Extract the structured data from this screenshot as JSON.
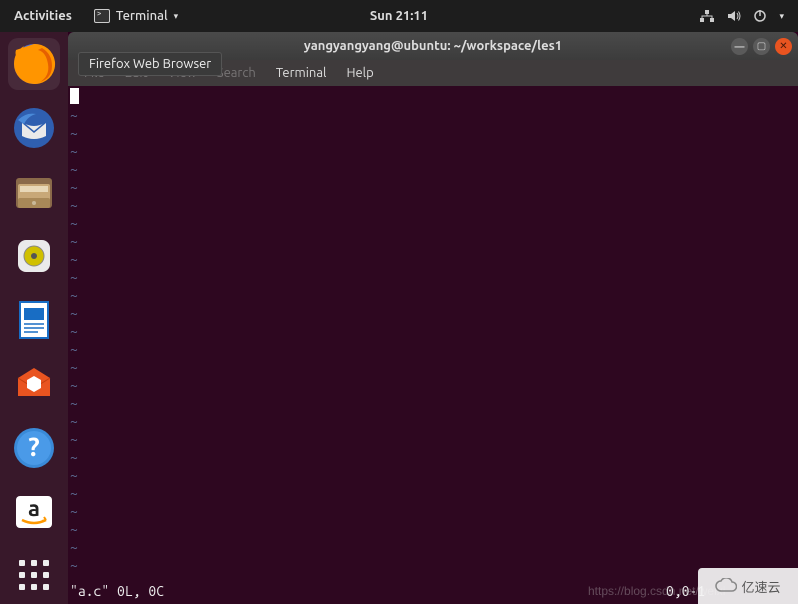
{
  "top_panel": {
    "activities": "Activities",
    "app_menu_label": "Terminal",
    "clock": "Sun 21:11"
  },
  "dock": {
    "tooltip_firefox": "Firefox Web Browser",
    "icons": [
      "firefox-icon",
      "thunderbird-icon",
      "files-icon",
      "rhythmbox-icon",
      "writer-icon",
      "software-icon",
      "help-icon",
      "amazon-icon"
    ]
  },
  "window": {
    "title": "yangyangyang@ubuntu: ~/workspace/les1",
    "menu": {
      "file": "File",
      "edit": "Edit",
      "view": "View",
      "search": "Search",
      "terminal": "Terminal",
      "help": "Help"
    }
  },
  "editor": {
    "tilde": "~",
    "tilde_count": 26,
    "status_file": "\"a.c\" 0L, 0C",
    "status_pos": "0,0-1"
  },
  "watermark": {
    "url": "https://blog.csdn.net/weixi",
    "logo_text": "亿速云"
  }
}
